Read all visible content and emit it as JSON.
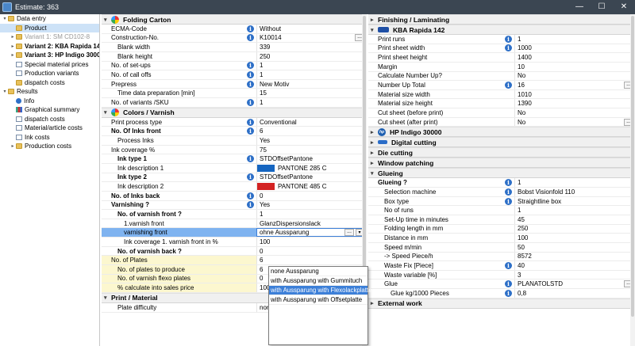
{
  "window": {
    "title": "Estimate: 363"
  },
  "tree": [
    {
      "label": "Data entry",
      "level": 0,
      "icon": "folder",
      "toggle": "▾",
      "bold": false
    },
    {
      "label": "Product",
      "level": 1,
      "icon": "folder",
      "toggle": "",
      "selected": true
    },
    {
      "label": "Variant 1: SM CD102-8",
      "level": 1,
      "icon": "folder",
      "toggle": "▸",
      "grey": true
    },
    {
      "label": "Variant 2: KBA Rapida 142",
      "level": 1,
      "icon": "folder",
      "toggle": "▸",
      "bold": true
    },
    {
      "label": "Variant 3: HP Indigo 30000",
      "level": 1,
      "icon": "folder",
      "toggle": "▸",
      "bold": true
    },
    {
      "label": "Special material prices",
      "level": 1,
      "icon": "doc",
      "toggle": ""
    },
    {
      "label": "Production variants",
      "level": 1,
      "icon": "doc",
      "toggle": ""
    },
    {
      "label": "dispatch costs",
      "level": 1,
      "icon": "folder",
      "toggle": ""
    },
    {
      "label": "Results",
      "level": 0,
      "icon": "folder",
      "toggle": "▾"
    },
    {
      "label": "Info",
      "level": 1,
      "icon": "info",
      "toggle": ""
    },
    {
      "label": "Graphical summary",
      "level": 1,
      "icon": "chart",
      "toggle": ""
    },
    {
      "label": "dispatch costs",
      "level": 1,
      "icon": "doc",
      "toggle": ""
    },
    {
      "label": "Material/article costs",
      "level": 1,
      "icon": "doc",
      "toggle": ""
    },
    {
      "label": "Ink costs",
      "level": 1,
      "icon": "doc",
      "toggle": ""
    },
    {
      "label": "Production costs",
      "level": 1,
      "icon": "folder",
      "toggle": "▸"
    }
  ],
  "middle": {
    "folding": {
      "title": "Folding Carton",
      "rows": [
        {
          "label": "ECMA-Code",
          "value": "Without",
          "info": true,
          "ell": false,
          "indent": 1
        },
        {
          "label": "Construction-No.",
          "value": "K10014",
          "info": true,
          "ell": true,
          "indent": 1
        },
        {
          "label": "Blank width",
          "value": "339",
          "indent": 2
        },
        {
          "label": "Blank height",
          "value": "250",
          "indent": 2
        },
        {
          "label": "No. of set-ups",
          "value": "1",
          "info": true,
          "indent": 1
        },
        {
          "label": "No. of call offs",
          "value": "1",
          "info": true,
          "indent": 1
        },
        {
          "label": "Prepress",
          "value": "New Motiv",
          "info": true,
          "indent": 1
        },
        {
          "label": "Time data preparation [min]",
          "value": "15",
          "indent": 2
        },
        {
          "label": "No. of variants /SKU",
          "value": "1",
          "info": true,
          "indent": 1
        }
      ]
    },
    "colors": {
      "title": "Colors / Varnish",
      "rows": [
        {
          "label": "Print process type",
          "value": "Conventional",
          "info": true,
          "indent": 1
        },
        {
          "label": "No. Of Inks front",
          "value": "6",
          "info": true,
          "bold": true,
          "indent": 1
        },
        {
          "label": "Process Inks",
          "value": "Yes",
          "indent": 2
        },
        {
          "label": "Ink coverage %",
          "value": "75",
          "indent": 1
        },
        {
          "label": "Ink type 1",
          "value": "STDOffsetPantone",
          "info": true,
          "bold": true,
          "indent": 2
        },
        {
          "label": "Ink description 1",
          "value": "PANTONE 285 C",
          "swatch": "#1565c0",
          "indent": 2
        },
        {
          "label": "Ink type 2",
          "value": "STDOffsetPantone",
          "info": true,
          "bold": true,
          "indent": 2
        },
        {
          "label": "Ink description 2",
          "value": "PANTONE 485 C",
          "swatch": "#d32222",
          "indent": 2
        },
        {
          "label": "No. of Inks back",
          "value": "0",
          "info": true,
          "bold": true,
          "indent": 1
        },
        {
          "label": "Varnishing ?",
          "value": "Yes",
          "info": true,
          "bold": true,
          "indent": 1
        },
        {
          "label": "No. of varnish front ?",
          "value": "1",
          "bold": true,
          "indent": 2
        },
        {
          "label": "1.varnish front",
          "value": "GlanzDispersionslack",
          "indent": 3
        },
        {
          "label": "varnishing front",
          "value": "ohne Aussparung",
          "indent": 3,
          "selected": true,
          "ell": true,
          "dd": true
        },
        {
          "label": "Ink coverage 1. varnish front in %",
          "value": "100",
          "indent": 3
        },
        {
          "label": "No. of varnish back ?",
          "value": "0",
          "bold": true,
          "indent": 2
        },
        {
          "label": "No. of Plates",
          "value": "6",
          "yellow": true,
          "indent": 1
        },
        {
          "label": "No. of plates to produce",
          "value": "6",
          "yellow": true,
          "indent": 2
        },
        {
          "label": "No. of varnish flexo plates",
          "value": "0",
          "yellow": true,
          "indent": 2
        },
        {
          "label": "% calculate into sales price",
          "value": "100",
          "yellow": true,
          "indent": 2
        }
      ]
    },
    "print": {
      "title": "Print / Material",
      "rows": [
        {
          "label": "Plate difficulty",
          "value": "nor",
          "indent": 2
        }
      ]
    },
    "dropdown": {
      "options": [
        "none Aussparung",
        "with Aussparung with Gummituch",
        "with Aussparung with Flexolackplatte",
        "with Aussparung with Offsetplatte"
      ],
      "highlighted": 2
    }
  },
  "right": {
    "finishing_title": "Finishing / Laminating",
    "kba": {
      "title": "KBA Rapida 142",
      "rows": [
        {
          "label": "Print runs",
          "value": "1",
          "info": true
        },
        {
          "label": "Print sheet width",
          "value": "1000",
          "info": true
        },
        {
          "label": "Print sheet height",
          "value": "1400"
        },
        {
          "label": "Margin",
          "value": "10"
        },
        {
          "label": "Calculate Number Up?",
          "value": "No"
        },
        {
          "label": "Number Up Total",
          "value": "16",
          "info": true,
          "ell": true
        },
        {
          "label": "Material size width",
          "value": "1010"
        },
        {
          "label": "Material size height",
          "value": "1390"
        },
        {
          "label": "Cut sheet (before print)",
          "value": "No"
        },
        {
          "label": "Cut sheet (after print)",
          "value": "No",
          "ell": true
        }
      ]
    },
    "collapsed": [
      {
        "title": "HP Indigo 30000",
        "logo": "hp"
      },
      {
        "title": "Digital cutting",
        "logo": "dig"
      },
      {
        "title": "Die cutting",
        "logo": ""
      },
      {
        "title": "Window patching",
        "logo": ""
      }
    ],
    "glueing": {
      "title": "Glueing",
      "rows": [
        {
          "label": "Glueing ?",
          "value": "1",
          "info": true,
          "bold": true,
          "indent": 1
        },
        {
          "label": "Selection machine",
          "value": "Bobst Visionfold 110",
          "info": true,
          "indent": 2
        },
        {
          "label": "Box type",
          "value": "Straightline box",
          "info": true,
          "indent": 2
        },
        {
          "label": "No of runs",
          "value": "1",
          "indent": 2
        },
        {
          "label": "Set-Up time in minutes",
          "value": "45",
          "indent": 2
        },
        {
          "label": "Folding length in mm",
          "value": "250",
          "indent": 2
        },
        {
          "label": "Distance in mm",
          "value": "100",
          "indent": 2
        },
        {
          "label": "Speed m/min",
          "value": "50",
          "indent": 2
        },
        {
          "label": "-> Speed Piece/h",
          "value": "8572",
          "indent": 2
        },
        {
          "label": "Waste Fix [Piece]",
          "value": "40",
          "info": true,
          "indent": 2
        },
        {
          "label": "Waste variable [%]",
          "value": "3",
          "indent": 2
        },
        {
          "label": "Glue",
          "value": "PLANATOLSTD",
          "info": true,
          "ell": true,
          "indent": 2
        },
        {
          "label": "Glue kg/1000 Pieces",
          "value": "0,8",
          "info": true,
          "indent": 3
        }
      ]
    },
    "external_title": "External work"
  }
}
